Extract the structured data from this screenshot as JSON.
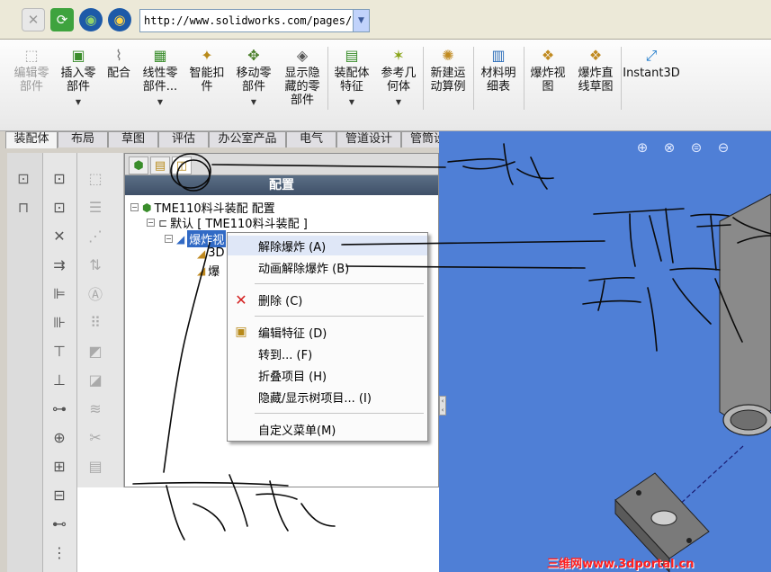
{
  "browser": {
    "url": "http://www.solidworks.com/pages/p"
  },
  "ribbon": {
    "buttons": [
      {
        "label": "编辑零\n部件",
        "icon": "edit-component-icon",
        "disabled": true
      },
      {
        "label": "插入零\n部件",
        "icon": "insert-component-icon",
        "caret": true
      },
      {
        "label": "配合",
        "icon": "mate-icon"
      },
      {
        "label": "线性零\n部件...",
        "icon": "linear-pattern-icon",
        "caret": true
      },
      {
        "label": "智能扣\n件",
        "icon": "smart-fastener-icon"
      },
      {
        "label": "移动零\n部件",
        "icon": "move-component-icon",
        "caret": true
      },
      {
        "label": "显示隐\n藏的零\n部件",
        "icon": "show-hidden-icon"
      },
      {
        "label": "装配体\n特征",
        "icon": "assembly-feature-icon",
        "caret": true
      },
      {
        "label": "参考几\n何体",
        "icon": "reference-geometry-icon",
        "caret": true
      },
      {
        "label": "新建运\n动算例",
        "icon": "motion-study-icon"
      },
      {
        "label": "材料明\n细表",
        "icon": "bom-icon"
      },
      {
        "label": "爆炸视\n图",
        "icon": "exploded-view-icon"
      },
      {
        "label": "爆炸直\n线草图",
        "icon": "explode-line-sketch-icon"
      },
      {
        "label": "Instant3D",
        "icon": "instant3d-icon"
      }
    ]
  },
  "tabs": [
    "装配体",
    "布局",
    "草图",
    "评估",
    "办公室产品",
    "电气",
    "管道设计",
    "管筒设计"
  ],
  "feature_manager": {
    "title": "配置",
    "tree": {
      "root": "TME110料斗装配 配置",
      "default_config": "默认 [ TME110料斗装配 ]",
      "selected": "爆炸视",
      "child1": "3D",
      "child2": "爆"
    }
  },
  "context_menu": {
    "items": [
      {
        "label": "解除爆炸 (A)",
        "icon": ""
      },
      {
        "label": "动画解除爆炸 (B)",
        "icon": ""
      },
      {
        "label": "删除 (C)",
        "icon": "delete-icon"
      },
      {
        "label": "编辑特征 (D)",
        "icon": "edit-feature-icon"
      },
      {
        "label": "转到... (F)",
        "icon": ""
      },
      {
        "label": "折叠项目 (H)",
        "icon": ""
      },
      {
        "label": "隐藏/显示树项目... (I)",
        "icon": ""
      },
      {
        "label": "自定义菜单(M)",
        "icon": ""
      }
    ]
  },
  "watermark": "三维网www.3dportal.cn",
  "colors": {
    "viewport_bg": "#4f7fd6",
    "selection": "#316ac5",
    "delete_red": "#d42020",
    "ink": "#0a0a0a"
  }
}
